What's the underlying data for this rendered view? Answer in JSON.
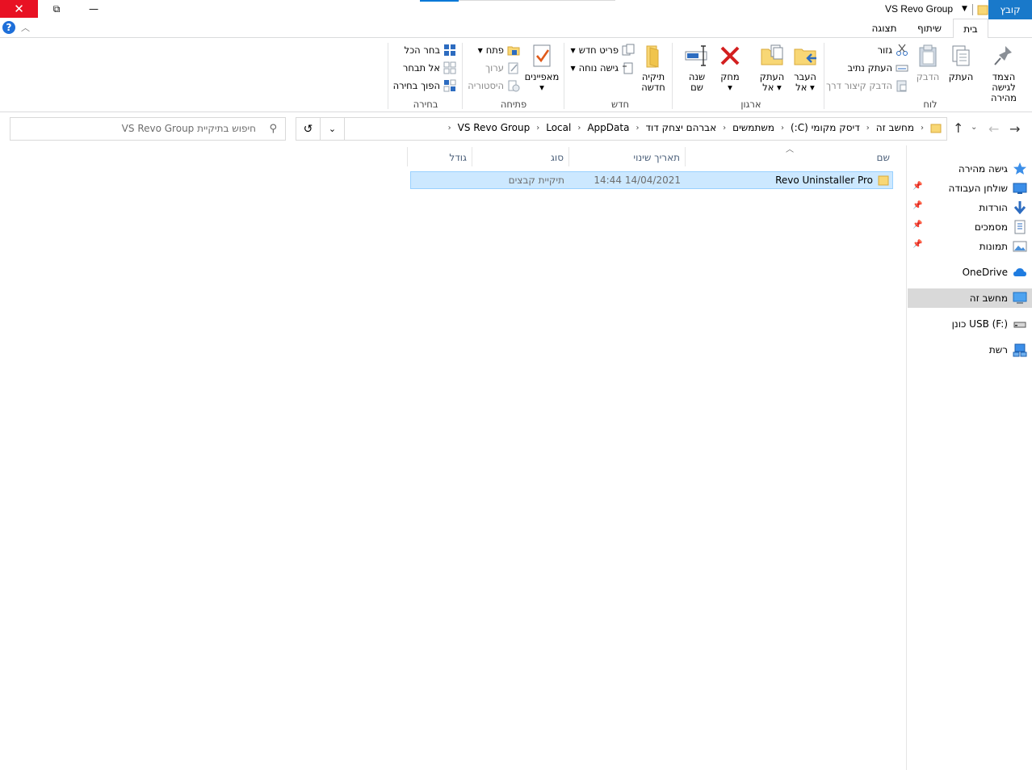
{
  "window": {
    "title": "VS Revo Group",
    "controls": {
      "close": "✕",
      "maximize": "⧉",
      "minimize": "—"
    }
  },
  "ribbon_tabs": [
    {
      "label": "קובץ",
      "active": false
    },
    {
      "label": "בית",
      "active": true
    },
    {
      "label": "שיתוף",
      "active": false
    },
    {
      "label": "תצוגה",
      "active": false
    }
  ],
  "ribbon": {
    "clipboard": {
      "label": "לוח",
      "pin": "הצמד לגישה\nמהירה",
      "pin_l1": "הצמד לגישה",
      "pin_l2": "מהירה",
      "copy": "העתק",
      "paste": "הדבק",
      "cut": "גזור",
      "copy_path": "העתק נתיב",
      "paste_shortcut": "הדבק קיצור דרך"
    },
    "organize": {
      "label": "ארגון",
      "move_to_l1": "העבר",
      "move_to_l2": "אל",
      "copy_to_l1": "העתק",
      "copy_to_l2": "אל",
      "delete": "מחק",
      "rename_l1": "שנה",
      "rename_l2": "שם"
    },
    "new": {
      "label": "חדש",
      "new_folder_l1": "תיקיה",
      "new_folder_l2": "חדשה",
      "new_item": "פריט חדש",
      "easy_access": "גישה נוחה"
    },
    "open": {
      "label": "פתיחה",
      "properties": "מאפיינים",
      "open": "פתח",
      "edit": "ערוך",
      "history": "היסטוריה"
    },
    "select": {
      "label": "בחירה",
      "select_all": "בחר הכל",
      "select_none": "אל תבחר",
      "invert": "הפוך בחירה"
    }
  },
  "address": {
    "crumbs": [
      "מחשב זה",
      "דיסק מקומי (C:)",
      "משתמשים",
      "אברהם יצחק דוד",
      "AppData",
      "Local",
      "VS Revo Group"
    ],
    "refresh_glyph": "↺",
    "dropdown_glyph": "⌄"
  },
  "search": {
    "placeholder": "חיפוש בתיקיית VS Revo Group"
  },
  "nav_pane": {
    "quick_access": "גישה מהירה",
    "items": [
      {
        "label": "שולחן העבודה",
        "icon": "desktop-icon",
        "pinned": true
      },
      {
        "label": "הורדות",
        "icon": "downloads-icon",
        "pinned": true
      },
      {
        "label": "מסמכים",
        "icon": "documents-icon",
        "pinned": true
      },
      {
        "label": "תמונות",
        "icon": "pictures-icon",
        "pinned": true
      }
    ],
    "onedrive": "OneDrive",
    "this_pc": "מחשב זה",
    "usb": "USB (F:) כונן",
    "network": "רשת"
  },
  "columns": {
    "name": "שם",
    "date": "תאריך שינוי",
    "type": "סוג",
    "size": "גודל"
  },
  "files": [
    {
      "name": "Revo Uninstaller Pro",
      "date": "14/04/2021 14:44",
      "type": "תיקיית קבצים",
      "size": "",
      "selected": true
    }
  ],
  "colors": {
    "file_tab": "#1979ca",
    "close_button": "#e81123",
    "selection": "#cce8ff",
    "selection_border": "#99d1ff",
    "folder": "#f8d775"
  }
}
